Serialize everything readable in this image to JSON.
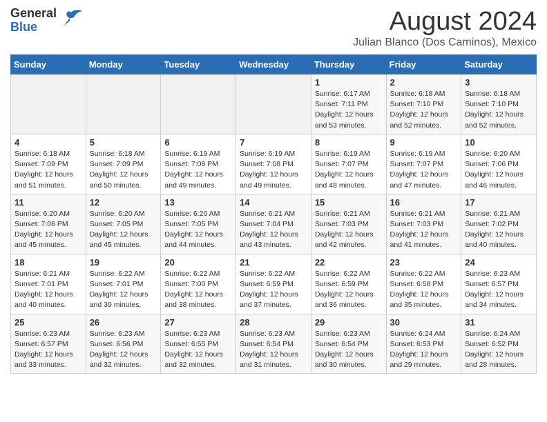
{
  "header": {
    "logo_general": "General",
    "logo_blue": "Blue",
    "month_title": "August 2024",
    "location": "Julian Blanco (Dos Caminos), Mexico"
  },
  "days_of_week": [
    "Sunday",
    "Monday",
    "Tuesday",
    "Wednesday",
    "Thursday",
    "Friday",
    "Saturday"
  ],
  "weeks": [
    [
      {
        "day": "",
        "info": ""
      },
      {
        "day": "",
        "info": ""
      },
      {
        "day": "",
        "info": ""
      },
      {
        "day": "",
        "info": ""
      },
      {
        "day": "1",
        "info": "Sunrise: 6:17 AM\nSunset: 7:11 PM\nDaylight: 12 hours\nand 53 minutes."
      },
      {
        "day": "2",
        "info": "Sunrise: 6:18 AM\nSunset: 7:10 PM\nDaylight: 12 hours\nand 52 minutes."
      },
      {
        "day": "3",
        "info": "Sunrise: 6:18 AM\nSunset: 7:10 PM\nDaylight: 12 hours\nand 52 minutes."
      }
    ],
    [
      {
        "day": "4",
        "info": "Sunrise: 6:18 AM\nSunset: 7:09 PM\nDaylight: 12 hours\nand 51 minutes."
      },
      {
        "day": "5",
        "info": "Sunrise: 6:18 AM\nSunset: 7:09 PM\nDaylight: 12 hours\nand 50 minutes."
      },
      {
        "day": "6",
        "info": "Sunrise: 6:19 AM\nSunset: 7:08 PM\nDaylight: 12 hours\nand 49 minutes."
      },
      {
        "day": "7",
        "info": "Sunrise: 6:19 AM\nSunset: 7:08 PM\nDaylight: 12 hours\nand 49 minutes."
      },
      {
        "day": "8",
        "info": "Sunrise: 6:19 AM\nSunset: 7:07 PM\nDaylight: 12 hours\nand 48 minutes."
      },
      {
        "day": "9",
        "info": "Sunrise: 6:19 AM\nSunset: 7:07 PM\nDaylight: 12 hours\nand 47 minutes."
      },
      {
        "day": "10",
        "info": "Sunrise: 6:20 AM\nSunset: 7:06 PM\nDaylight: 12 hours\nand 46 minutes."
      }
    ],
    [
      {
        "day": "11",
        "info": "Sunrise: 6:20 AM\nSunset: 7:06 PM\nDaylight: 12 hours\nand 45 minutes."
      },
      {
        "day": "12",
        "info": "Sunrise: 6:20 AM\nSunset: 7:05 PM\nDaylight: 12 hours\nand 45 minutes."
      },
      {
        "day": "13",
        "info": "Sunrise: 6:20 AM\nSunset: 7:05 PM\nDaylight: 12 hours\nand 44 minutes."
      },
      {
        "day": "14",
        "info": "Sunrise: 6:21 AM\nSunset: 7:04 PM\nDaylight: 12 hours\nand 43 minutes."
      },
      {
        "day": "15",
        "info": "Sunrise: 6:21 AM\nSunset: 7:03 PM\nDaylight: 12 hours\nand 42 minutes."
      },
      {
        "day": "16",
        "info": "Sunrise: 6:21 AM\nSunset: 7:03 PM\nDaylight: 12 hours\nand 41 minutes."
      },
      {
        "day": "17",
        "info": "Sunrise: 6:21 AM\nSunset: 7:02 PM\nDaylight: 12 hours\nand 40 minutes."
      }
    ],
    [
      {
        "day": "18",
        "info": "Sunrise: 6:21 AM\nSunset: 7:01 PM\nDaylight: 12 hours\nand 40 minutes."
      },
      {
        "day": "19",
        "info": "Sunrise: 6:22 AM\nSunset: 7:01 PM\nDaylight: 12 hours\nand 39 minutes."
      },
      {
        "day": "20",
        "info": "Sunrise: 6:22 AM\nSunset: 7:00 PM\nDaylight: 12 hours\nand 38 minutes."
      },
      {
        "day": "21",
        "info": "Sunrise: 6:22 AM\nSunset: 6:59 PM\nDaylight: 12 hours\nand 37 minutes."
      },
      {
        "day": "22",
        "info": "Sunrise: 6:22 AM\nSunset: 6:59 PM\nDaylight: 12 hours\nand 36 minutes."
      },
      {
        "day": "23",
        "info": "Sunrise: 6:22 AM\nSunset: 6:58 PM\nDaylight: 12 hours\nand 35 minutes."
      },
      {
        "day": "24",
        "info": "Sunrise: 6:23 AM\nSunset: 6:57 PM\nDaylight: 12 hours\nand 34 minutes."
      }
    ],
    [
      {
        "day": "25",
        "info": "Sunrise: 6:23 AM\nSunset: 6:57 PM\nDaylight: 12 hours\nand 33 minutes."
      },
      {
        "day": "26",
        "info": "Sunrise: 6:23 AM\nSunset: 6:56 PM\nDaylight: 12 hours\nand 32 minutes."
      },
      {
        "day": "27",
        "info": "Sunrise: 6:23 AM\nSunset: 6:55 PM\nDaylight: 12 hours\nand 32 minutes."
      },
      {
        "day": "28",
        "info": "Sunrise: 6:23 AM\nSunset: 6:54 PM\nDaylight: 12 hours\nand 31 minutes."
      },
      {
        "day": "29",
        "info": "Sunrise: 6:23 AM\nSunset: 6:54 PM\nDaylight: 12 hours\nand 30 minutes."
      },
      {
        "day": "30",
        "info": "Sunrise: 6:24 AM\nSunset: 6:53 PM\nDaylight: 12 hours\nand 29 minutes."
      },
      {
        "day": "31",
        "info": "Sunrise: 6:24 AM\nSunset: 6:52 PM\nDaylight: 12 hours\nand 28 minutes."
      }
    ]
  ]
}
